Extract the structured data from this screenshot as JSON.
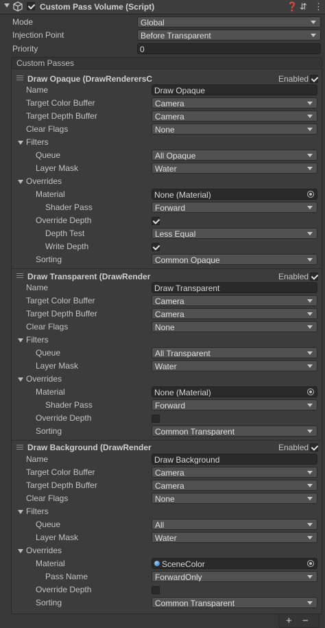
{
  "component": {
    "title": "Custom Pass Volume (Script)",
    "icons": [
      "help-icon",
      "preset-icon",
      "more-icon"
    ]
  },
  "fields": {
    "mode": {
      "label": "Mode",
      "value": "Global"
    },
    "injection": {
      "label": "Injection Point",
      "value": "Before Transparent"
    },
    "priority": {
      "label": "Priority",
      "value": "0"
    }
  },
  "custom_passes_label": "Custom Passes",
  "passes": [
    {
      "title": "Draw Opaque (DrawRenderersC",
      "enabled_label": "Enabled",
      "name_label": "Name",
      "name": "Draw Opaque",
      "target_color_label": "Target Color Buffer",
      "target_color": "Camera",
      "target_depth_label": "Target Depth Buffer",
      "target_depth": "Camera",
      "clear_flags_label": "Clear Flags",
      "clear_flags": "None",
      "filters_label": "Filters",
      "queue_label": "Queue",
      "queue": "All Opaque",
      "layer_mask_label": "Layer Mask",
      "layer_mask": "Water",
      "overrides_label": "Overrides",
      "material_label": "Material",
      "material": "None (Material)",
      "shader_pass_label": "Shader Pass",
      "shader_pass": "Forward",
      "override_depth_label": "Override Depth",
      "depth_test_label": "Depth Test",
      "depth_test": "Less Equal",
      "write_depth_label": "Write Depth",
      "sorting_label": "Sorting",
      "sorting": "Common Opaque"
    },
    {
      "title": "Draw Transparent (DrawRender",
      "enabled_label": "Enabled",
      "name_label": "Name",
      "name": "Draw Transparent",
      "target_color_label": "Target Color Buffer",
      "target_color": "Camera",
      "target_depth_label": "Target Depth Buffer",
      "target_depth": "Camera",
      "clear_flags_label": "Clear Flags",
      "clear_flags": "None",
      "filters_label": "Filters",
      "queue_label": "Queue",
      "queue": "All Transparent",
      "layer_mask_label": "Layer Mask",
      "layer_mask": "Water",
      "overrides_label": "Overrides",
      "material_label": "Material",
      "material": "None (Material)",
      "shader_pass_label": "Shader Pass",
      "shader_pass": "Forward",
      "override_depth_label": "Override Depth",
      "sorting_label": "Sorting",
      "sorting": "Common Transparent"
    },
    {
      "title": "Draw Background (DrawRender",
      "enabled_label": "Enabled",
      "name_label": "Name",
      "name": "Draw Background",
      "target_color_label": "Target Color Buffer",
      "target_color": "Camera",
      "target_depth_label": "Target Depth Buffer",
      "target_depth": "Camera",
      "clear_flags_label": "Clear Flags",
      "clear_flags": "None",
      "filters_label": "Filters",
      "queue_label": "Queue",
      "queue": "All",
      "layer_mask_label": "Layer Mask",
      "layer_mask": "Water",
      "overrides_label": "Overrides",
      "material_label": "Material",
      "material": "SceneColor",
      "pass_name_label": "Pass Name",
      "pass_name": "ForwardOnly",
      "override_depth_label": "Override Depth",
      "sorting_label": "Sorting",
      "sorting": "Common Transparent"
    }
  ],
  "footer": {
    "add": "+",
    "remove": "−"
  }
}
